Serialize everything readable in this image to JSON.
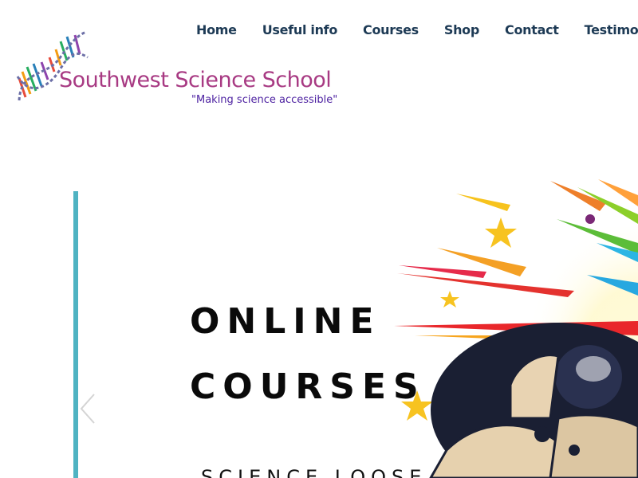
{
  "nav": {
    "items": [
      {
        "label": "Home"
      },
      {
        "label": "Useful info"
      },
      {
        "label": "Courses"
      },
      {
        "label": "Shop"
      },
      {
        "label": "Contact"
      },
      {
        "label": "Testimonia"
      }
    ]
  },
  "logo": {
    "name": "Southwest Science School",
    "tagline": "\"Making science accessible\"",
    "icon": "dna-helix-icon"
  },
  "hero": {
    "title_line1": "ONLINE",
    "title_line2": "COURSES",
    "subtitle": "SCIENCE LOOSE",
    "prev_icon": "chevron-left-icon",
    "colors": {
      "accent_bar": "#4fb3c2",
      "nav": "#1d3a55",
      "logo_name": "#a83a83",
      "tagline": "#4b1fa0"
    }
  }
}
